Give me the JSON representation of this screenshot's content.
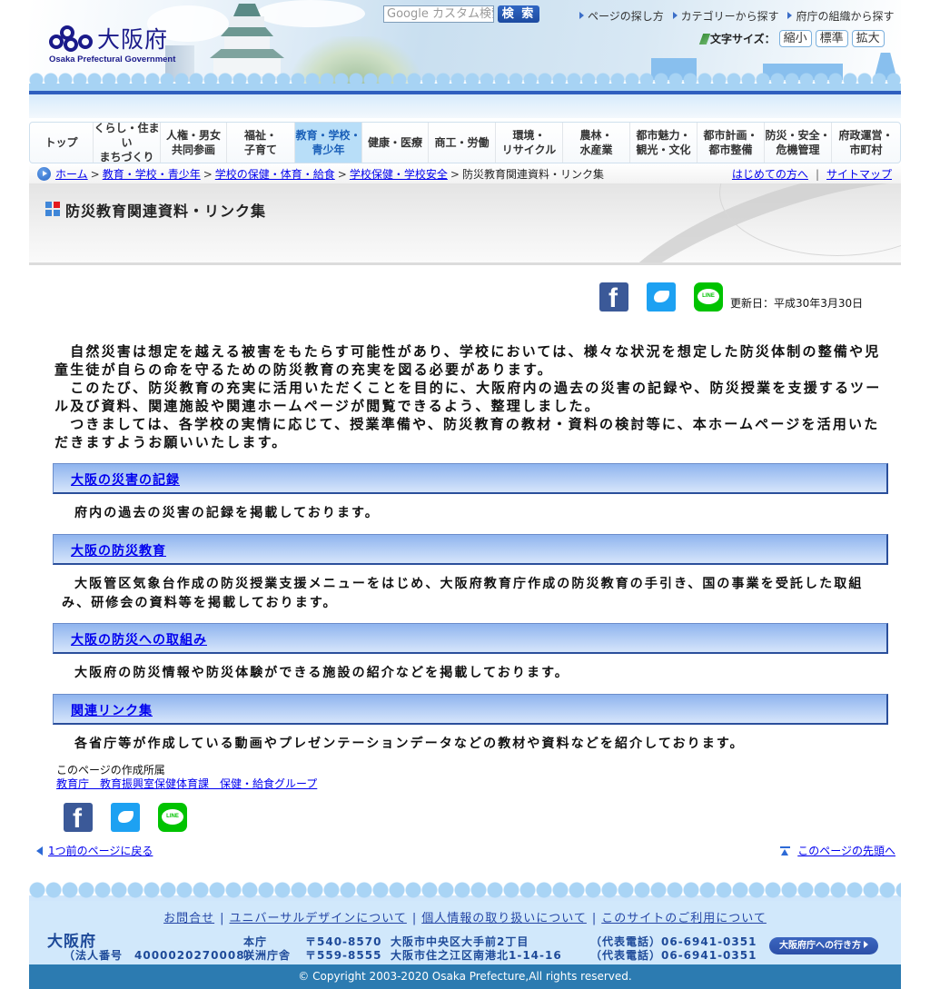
{
  "header": {
    "logo_name": "大阪府",
    "logo_english": "Osaka Prefectural Government",
    "search": {
      "placeholder": "Google カスタム検索",
      "button_label": "検 索"
    },
    "top_links": [
      {
        "label": "ページの探し方"
      },
      {
        "label": "カテゴリーから探す"
      },
      {
        "label": "府庁の組織から探す"
      }
    ],
    "font_size": {
      "label": "文字サイズ：",
      "buttons": [
        "縮小",
        "標準",
        "拡大"
      ]
    }
  },
  "global_nav": [
    {
      "label": "トップ",
      "active": false
    },
    {
      "label": "くらし・住まい\nまちづくり",
      "active": false
    },
    {
      "label": "人権・男女\n共同参画",
      "active": false
    },
    {
      "label": "福祉・\n子育て",
      "active": false
    },
    {
      "label": "教育・学校・\n青少年",
      "active": true
    },
    {
      "label": "健康・医療",
      "active": false
    },
    {
      "label": "商工・労働",
      "active": false
    },
    {
      "label": "環境・\nリサイクル",
      "active": false
    },
    {
      "label": "農林・\n水産業",
      "active": false
    },
    {
      "label": "都市魅力・\n観光・文化",
      "active": false
    },
    {
      "label": "都市計画・\n都市整備",
      "active": false
    },
    {
      "label": "防災・安全・\n危機管理",
      "active": false
    },
    {
      "label": "府政運営・\n市町村",
      "active": false
    }
  ],
  "breadcrumb": {
    "items": [
      "ホーム",
      "教育・学校・青少年",
      "学校の保健・体育・給食",
      "学校保健・学校安全"
    ],
    "current": "防災教育関連資料・リンク集",
    "separator": ">",
    "right_links": [
      "はじめての方へ",
      "サイトマップ"
    ]
  },
  "page": {
    "title": "防災教育関連資料・リンク集",
    "updated": "更新日：平成30年3月30日",
    "share": [
      "facebook",
      "twitter",
      "line"
    ],
    "intro": [
      "　自然災害は想定を越える被害をもたらす可能性があり、学校においては、様々な状況を想定した防災体制の整備や児童生徒が自らの命を守るための防災教育の充実を図る必要があります。",
      "　このたび、防災教育の充実に活用いただくことを目的に、大阪府内の過去の災害の記録や、防災授業を支援するツール及び資料、関連施設や関連ホームページが閲覧できるよう、整理しました。",
      "　つきましては、各学校の実情に応じて、授業準備や、防災教育の教材・資料の検討等に、本ホームページを活用いただきますようお願いいたします。"
    ],
    "sections": [
      {
        "heading": "大阪の災害の記録",
        "description": "府内の過去の災害の記録を掲載しております。"
      },
      {
        "heading": "大阪の防災教育",
        "description": "大阪管区気象台作成の防災授業支援メニューをはじめ、大阪府教育庁作成の防災教育の手引き、国の事業を受託した取組み、研修会の資料等を掲載しております。"
      },
      {
        "heading": "大阪の防災への取組み",
        "description": "大阪府の防災情報や防災体験ができる施設の紹介などを掲載しております。"
      },
      {
        "heading": "関連リンク集",
        "description": "各省庁等が作成している動画やプレゼンテーションデータなどの教材や資料などを紹介しております。"
      }
    ],
    "owner_label": "このページの作成所属",
    "owner_link": "教育庁　教育振興室保健体育課　保健・給食グループ",
    "back_link": "1つ前のページに戻る",
    "top_link": "このページの先頭へ"
  },
  "footer": {
    "links": [
      "お問合せ",
      "ユニバーサルデザインについて",
      "個人情報の取り扱いについて",
      "このサイトのご利用について"
    ],
    "org_name": "大阪府",
    "corp_number": "（法人番号　4000020270008）",
    "offices": [
      {
        "name": "本庁",
        "postal": "〒540-8570",
        "address": "大阪市中央区大手前2丁目",
        "phone": "（代表電話）06-6941-0351"
      },
      {
        "name": "咲洲庁舎",
        "postal": "〒559-8555",
        "address": "大阪市住之江区南港北1-14-16",
        "phone": "（代表電話）06-6941-0351"
      }
    ],
    "access_button": "大阪府庁への行き方",
    "copyright": "© Copyright 2003-2020 Osaka Prefecture,All rights reserved."
  },
  "colors": {
    "brand_navy": "#1a1a8a",
    "nav_active_bg": "#b8def8",
    "section_border": "#2b4f9b",
    "footer_bg": "#d1e8fb",
    "copyright_bg": "#2c7bb1",
    "link": "#0000ee"
  }
}
